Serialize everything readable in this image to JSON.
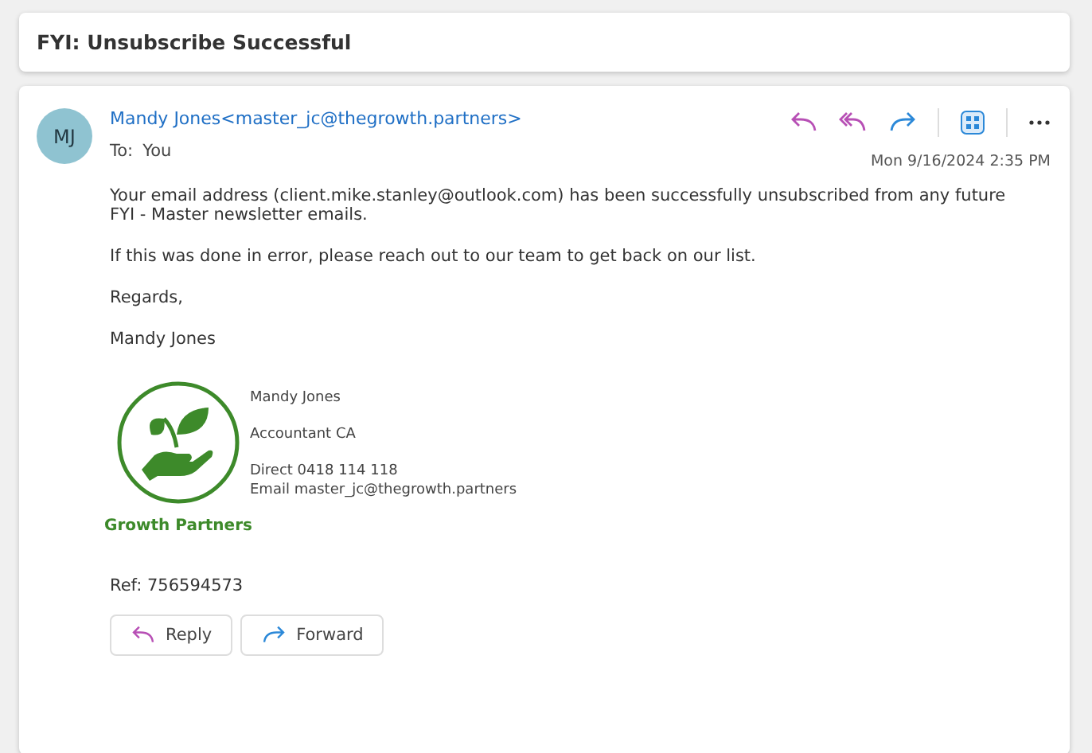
{
  "subject": "FYI: Unsubscribe Successful",
  "message": {
    "initials": "MJ",
    "sender": "Mandy Jones<master_jc@thegrowth.partners>",
    "to_label": "To:",
    "to": "You",
    "date": "Mon 9/16/2024 2:35 PM",
    "paragraphs": [
      "Your email address (client.mike.stanley@outlook.com) has been successfully unsubscribed from any future FYI - Master newsletter emails.",
      "If this was done in error, please reach out to our team to get back on our list.",
      "Regards,",
      "Mandy Jones"
    ],
    "signature": {
      "company": "Growth Partners",
      "name": "Mandy Jones",
      "title": "Accountant CA",
      "direct": "Direct 0418 114 118",
      "email": "Email master_jc@thegrowth.partners"
    },
    "ref": "Ref: 756594573",
    "actions": [
      {
        "label": "Reply",
        "kind": "reply"
      },
      {
        "label": "Forward",
        "kind": "forward"
      }
    ]
  }
}
